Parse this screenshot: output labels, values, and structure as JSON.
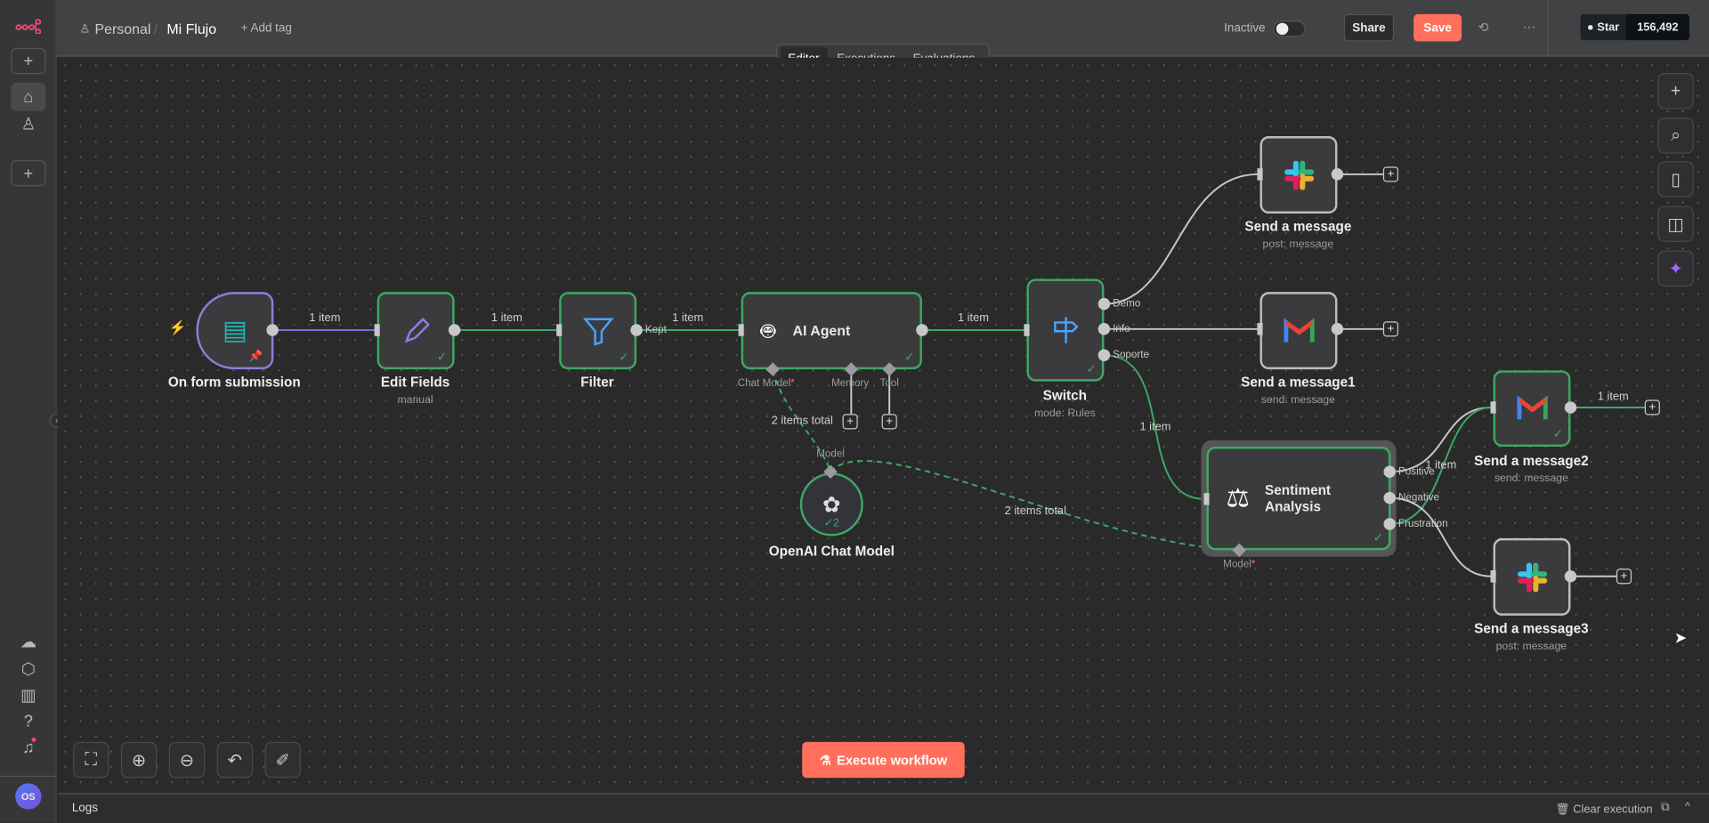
{
  "colors": {
    "accent": "#ff6f5c",
    "success": "#3ea863",
    "trigger_edge": "#7b6fe0",
    "brand": "#ea4b71"
  },
  "sidebar": {
    "top_icons": [
      "n8n-logo-icon",
      "plus-icon",
      "home-icon",
      "user-icon",
      "plus-icon"
    ],
    "bottom_icons": [
      "cloud-icon",
      "package-icon",
      "chart-icon",
      "help-icon",
      "bell-icon"
    ],
    "avatar_initials": "OS"
  },
  "header": {
    "project": "Personal",
    "separator": "/",
    "workflow_name": "Mi Flujo",
    "add_tag": "+ Add tag",
    "tabs": [
      {
        "label": "Editor",
        "active": true
      },
      {
        "label": "Executions"
      },
      {
        "label": "Evaluations"
      }
    ],
    "status_label": "Inactive",
    "active": false,
    "share": "Share",
    "save": "Save",
    "github_star": "Star",
    "github_count": "156,492"
  },
  "nodes": {
    "form": {
      "label": "On form submission",
      "icon": "form-icon"
    },
    "edit": {
      "label": "Edit Fields",
      "sub": "manual",
      "icon": "pencil-icon"
    },
    "filter": {
      "label": "Filter",
      "icon": "filter-icon",
      "output": "Kept"
    },
    "agent": {
      "label": "AI Agent",
      "icon": "robot-icon",
      "ports": [
        "Chat Model",
        "Memory",
        "Tool"
      ],
      "required_mark": "*"
    },
    "switch": {
      "label": "Switch",
      "sub": "mode: Rules",
      "icon": "signpost-icon",
      "outputs": [
        "Demo",
        "Info",
        "Soporte"
      ]
    },
    "slack1": {
      "label": "Send a message",
      "sub": "post: message",
      "icon": "slack-icon"
    },
    "gmail1": {
      "label": "Send a message1",
      "sub": "send: message",
      "icon": "gmail-icon"
    },
    "sentiment": {
      "label_line1": "Sentiment",
      "label_line2": "Analysis",
      "icon": "scale-icon",
      "outputs": [
        "Positive",
        "Negative",
        "Frustration"
      ],
      "port": "Model"
    },
    "gmail2": {
      "label": "Send a message2",
      "sub": "send: message",
      "icon": "gmail-icon"
    },
    "slack2": {
      "label": "Send a message3",
      "sub": "post: message",
      "icon": "slack-icon"
    },
    "openai": {
      "label": "OpenAI Chat Model",
      "port": "Model",
      "runs": "2",
      "icon": "openai-icon"
    }
  },
  "edges": {
    "e1": "1 item",
    "e2": "1 item",
    "e3": "1 item",
    "e4": "1 item",
    "e5": "1 item",
    "e6": "1 item",
    "e7": "1 item",
    "m1": "2 items total",
    "m2": "2 items total"
  },
  "footer": {
    "execute": "Execute workflow",
    "logs": "Logs",
    "clear": "Clear execution"
  }
}
